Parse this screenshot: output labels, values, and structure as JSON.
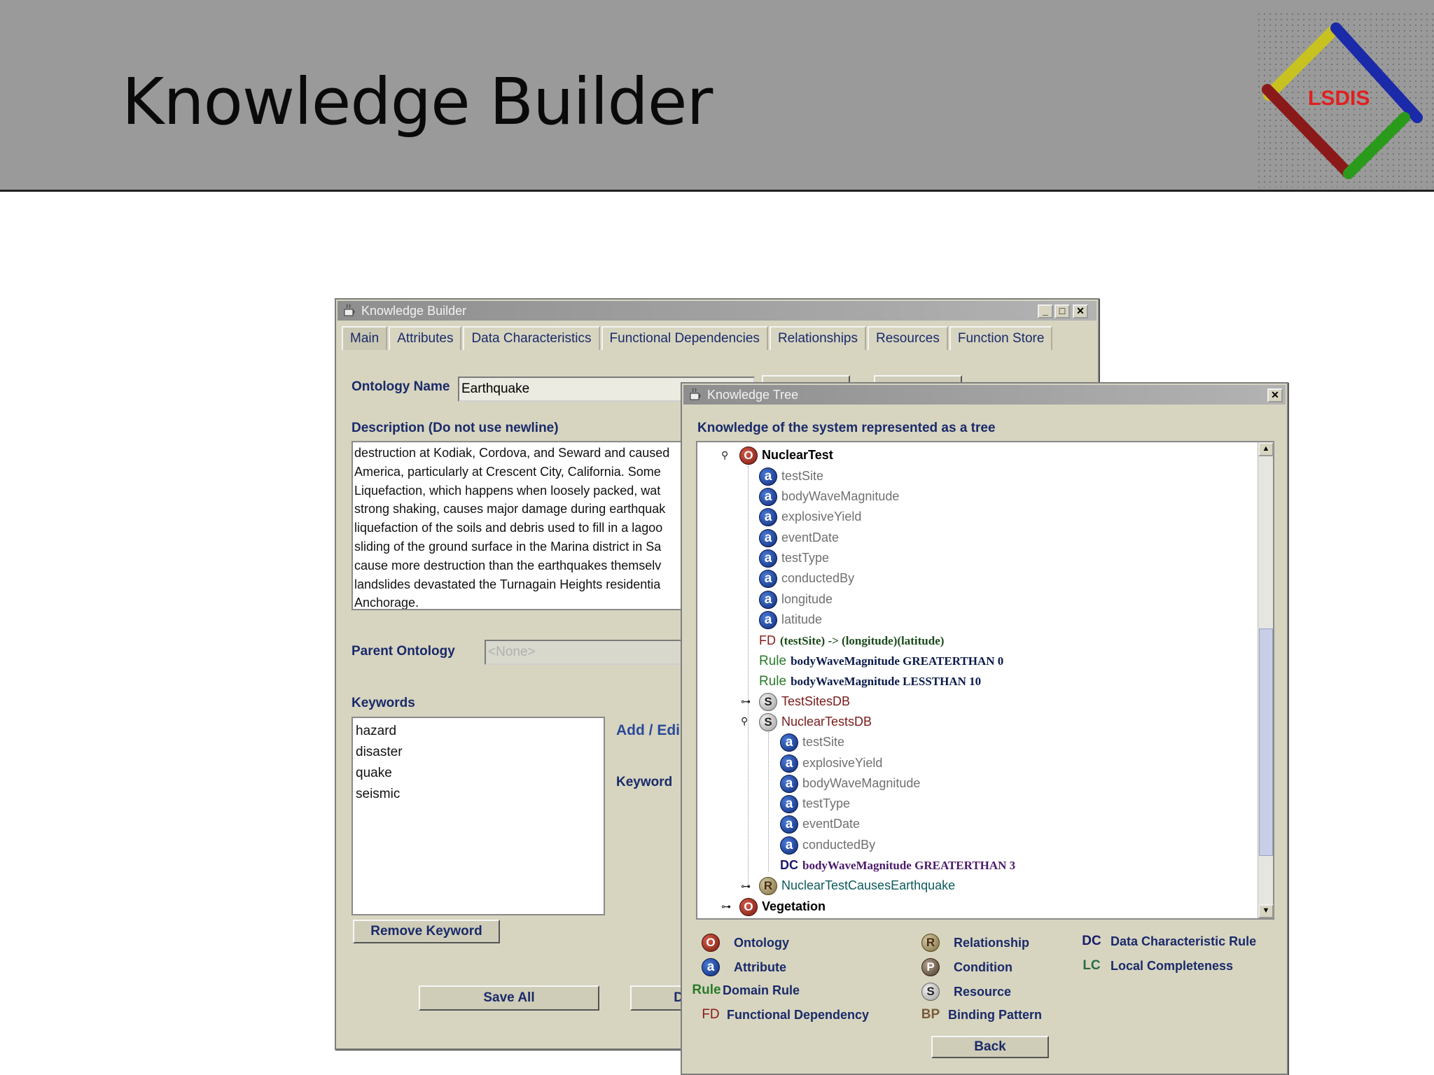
{
  "slide": {
    "title": "Knowledge Builder",
    "logo_text": "LSDIS"
  },
  "main_window": {
    "title": "Knowledge Builder",
    "controls": {
      "minimize": "_",
      "maximize": "□",
      "close": "✕"
    },
    "tabs": [
      {
        "label": "Main",
        "active": true
      },
      {
        "label": "Attributes"
      },
      {
        "label": "Data Characteristics"
      },
      {
        "label": "Functional Dependencies"
      },
      {
        "label": "Relationships"
      },
      {
        "label": "Resources"
      },
      {
        "label": "Function Store"
      }
    ],
    "ontology_name_label": "Ontology Name",
    "ontology_name_value": "Earthquake",
    "description_label": "Description (Do not use newline)",
    "description_lines": [
      "destruction at Kodiak, Cordova, and Seward and caused",
      "America, particularly at Crescent City, California. Some",
      "Liquefaction, which happens when loosely packed, wat",
      "strong shaking, causes major damage during earthquak",
      "liquefaction of the soils and debris used to fill in a lagoo",
      "sliding of the ground surface in the Marina district in Sa",
      "cause more destruction than the earthquakes themselv",
      "landslides devastated the Turnagain Heights residentia",
      "Anchorage."
    ],
    "parent_ontology_label": "Parent Ontology",
    "parent_ontology_value": "<None>",
    "keywords_label": "Keywords",
    "keywords": [
      "hazard",
      "disaster",
      "quake",
      "seismic"
    ],
    "add_edit_label": "Add / Edi",
    "keyword_label": "Keyword",
    "remove_keyword_button": "Remove Keyword",
    "save_all_button": "Save All",
    "partial_button": "D"
  },
  "tree_window": {
    "title": "Knowledge Tree",
    "close": "✕",
    "heading": "Knowledge of the system represented as a tree",
    "rows": [
      {
        "type": "ontology",
        "icon": "O",
        "text": "NuclearTest"
      },
      {
        "type": "attribute",
        "icon": "a",
        "text": "testSite"
      },
      {
        "type": "attribute",
        "icon": "a",
        "text": "bodyWaveMagnitude"
      },
      {
        "type": "attribute",
        "icon": "a",
        "text": "explosiveYield"
      },
      {
        "type": "attribute",
        "icon": "a",
        "text": "eventDate"
      },
      {
        "type": "attribute",
        "icon": "a",
        "text": "testType"
      },
      {
        "type": "attribute",
        "icon": "a",
        "text": "conductedBy"
      },
      {
        "type": "attribute",
        "icon": "a",
        "text": "longitude"
      },
      {
        "type": "attribute",
        "icon": "a",
        "text": "latitude"
      },
      {
        "type": "fd",
        "tag": "FD",
        "text": "(testSite) -> (longitude)(latitude)"
      },
      {
        "type": "rule",
        "tag": "Rule",
        "text": "bodyWaveMagnitude GREATERTHAN 0"
      },
      {
        "type": "rule",
        "tag": "Rule",
        "text": "bodyWaveMagnitude LESSTHAN 10"
      },
      {
        "type": "resource",
        "icon": "S",
        "text": "TestSitesDB"
      },
      {
        "type": "resource",
        "icon": "S",
        "text": "NuclearTestsDB"
      },
      {
        "type": "attribute",
        "icon": "a",
        "text": "testSite"
      },
      {
        "type": "attribute",
        "icon": "a",
        "text": "explosiveYield"
      },
      {
        "type": "attribute",
        "icon": "a",
        "text": "bodyWaveMagnitude"
      },
      {
        "type": "attribute",
        "icon": "a",
        "text": "testType"
      },
      {
        "type": "attribute",
        "icon": "a",
        "text": "eventDate"
      },
      {
        "type": "attribute",
        "icon": "a",
        "text": "conductedBy"
      },
      {
        "type": "dc",
        "tag": "DC",
        "text": "bodyWaveMagnitude GREATERTHAN 3"
      },
      {
        "type": "relationship",
        "icon": "R",
        "text": "NuclearTestCausesEarthquake"
      },
      {
        "type": "ontology",
        "icon": "O",
        "text": "Vegetation"
      }
    ],
    "legend": [
      {
        "icon": "O",
        "label": "Ontology"
      },
      {
        "icon": "a",
        "label": "Attribute"
      },
      {
        "icon": "Rule",
        "label": "Domain Rule"
      },
      {
        "icon": "FD",
        "label": "Functional Dependency"
      },
      {
        "icon": "R",
        "label": "Relationship"
      },
      {
        "icon": "P",
        "label": "Condition"
      },
      {
        "icon": "S",
        "label": "Resource"
      },
      {
        "icon": "BP",
        "label": "Binding Pattern"
      },
      {
        "icon": "DC",
        "label": "Data Characteristic Rule"
      },
      {
        "icon": "LC",
        "label": "Local Completeness"
      }
    ],
    "back_button": "Back"
  },
  "colors": {
    "window_bg": "#d7d5c0",
    "label_blue": "#1a2a6a",
    "header_grey": "#9a9a9a"
  }
}
